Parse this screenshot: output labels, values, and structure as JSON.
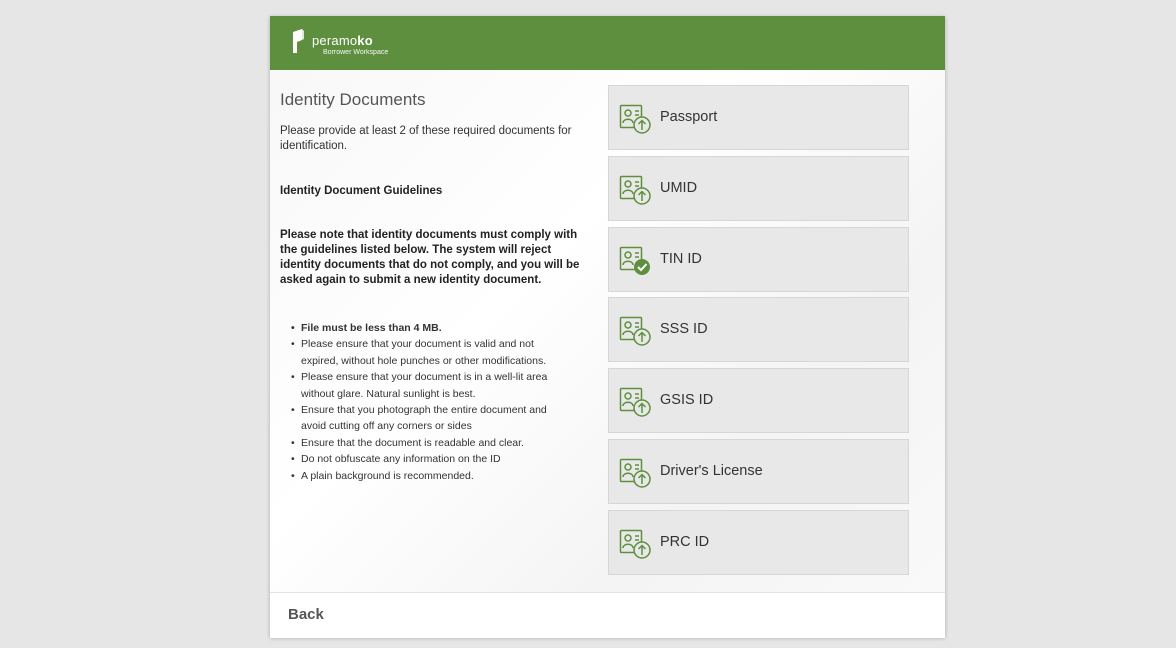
{
  "brand": {
    "name_regular": "peramo",
    "name_bold": "ko",
    "subtitle": "Borrower Workspace",
    "header_color": "#5e8f3e",
    "icon_color": "#5e8f3e"
  },
  "left": {
    "title": "Identity Documents",
    "intro": "Please provide at least 2 of these required documents for identification.",
    "guidelines_title": "Identity Document Guidelines",
    "note": "Please note that identity documents must comply with the guidelines listed below. The system will reject identity documents that do not comply, and you will be asked again to submit a new identity document.",
    "rules": [
      "File must be less than 4 MB.",
      "Please ensure that your document is valid and not expired, without hole punches or other modifications.",
      "Please ensure that your document is in a well-lit area without glare. Natural sunlight is best.",
      "Ensure that you photograph the entire document and avoid cutting off any corners or sides",
      "Ensure that the document is readable and clear.",
      "Do not obfuscate any information on the ID",
      "A plain background is recommended."
    ]
  },
  "documents": [
    {
      "label": "Passport",
      "status": "upload",
      "icon": "id-upload-icon"
    },
    {
      "label": "UMID",
      "status": "upload",
      "icon": "id-upload-icon"
    },
    {
      "label": "TIN ID",
      "status": "uploaded",
      "icon": "id-check-icon"
    },
    {
      "label": "SSS ID",
      "status": "upload",
      "icon": "id-upload-icon"
    },
    {
      "label": "GSIS ID",
      "status": "upload",
      "icon": "id-upload-icon"
    },
    {
      "label": "Driver's License",
      "status": "upload",
      "icon": "id-upload-icon"
    },
    {
      "label": "PRC ID",
      "status": "upload",
      "icon": "id-upload-icon"
    }
  ],
  "footer": {
    "back_label": "Back"
  }
}
